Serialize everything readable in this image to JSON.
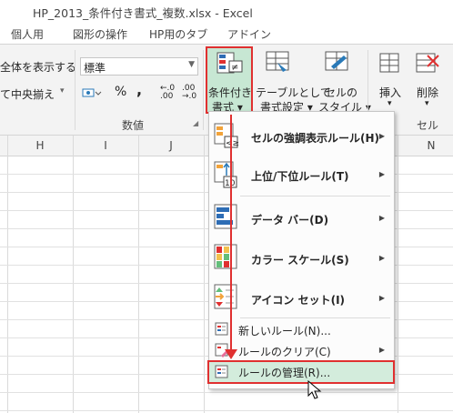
{
  "window": {
    "title": "HP_2013_条件付き書式_複数.xlsx - Excel"
  },
  "tabs": [
    "個人用",
    "図形の操作",
    "HP用のタブ",
    "アドイン"
  ],
  "ribbon": {
    "alignment": {
      "show_all": "全体を表示する",
      "merge_center": "て中央揃え"
    },
    "number": {
      "format_value": "標準",
      "percent": "%",
      "comma": ",",
      "decimal_inc": "←.0\n.00",
      "decimal_dec": ".00\n→.0",
      "group_label": "数値"
    },
    "styles": {
      "conditional_format": {
        "line1": "条件付き",
        "line2": "書式 ▾"
      },
      "format_as_table": {
        "line1": "テーブルとして",
        "line2": "書式設定 ▾"
      },
      "cell_styles": {
        "line1": "セルの",
        "line2": "スタイル ▾"
      }
    },
    "cells": {
      "insert": {
        "line1": "挿入",
        "line2": "▾"
      },
      "delete": {
        "line1": "削除",
        "line2": "▾"
      },
      "group_label": "セル"
    }
  },
  "columns": [
    "H",
    "I",
    "J",
    "N"
  ],
  "menu": {
    "items": [
      {
        "label": "セルの強調表示ルール(H)"
      },
      {
        "label": "上位/下位ルール(T)"
      },
      {
        "label": "データ バー(D)"
      },
      {
        "label": "カラー スケール(S)"
      },
      {
        "label": "アイコン セット(I)"
      },
      {
        "label": "新しいルール(N)..."
      },
      {
        "label": "ルールのクリア(C)"
      },
      {
        "label": "ルールの管理(R)..."
      }
    ]
  },
  "colors": {
    "highlight_border": "#e03030",
    "highlight_fill": "#c7e7d3",
    "menu_hover": "#d3ecdc"
  }
}
